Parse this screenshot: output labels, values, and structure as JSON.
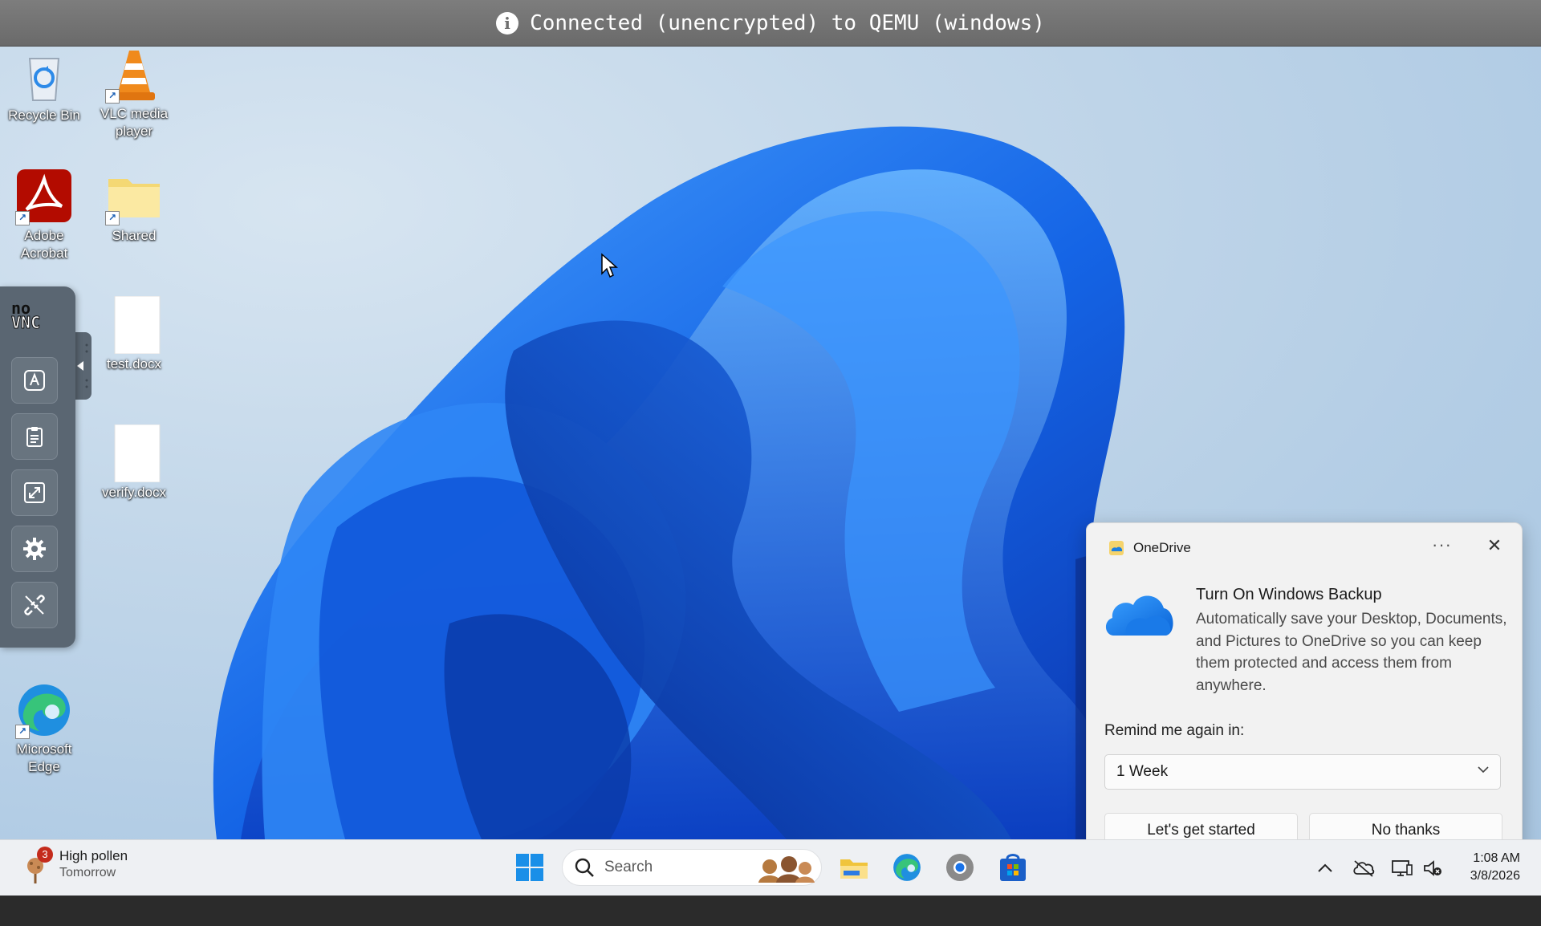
{
  "vnc": {
    "status_text": "Connected (unencrypted) to QEMU (windows)"
  },
  "desktop": {
    "icons": [
      {
        "label": "Recycle Bin",
        "icon": "recycle-bin-icon"
      },
      {
        "label": "VLC media player",
        "icon": "vlc-icon"
      },
      {
        "label": "Adobe Acrobat",
        "icon": "adobe-acrobat-icon"
      },
      {
        "label": "Shared",
        "icon": "folder-icon"
      },
      {
        "label": "test.docx",
        "icon": "document-icon"
      },
      {
        "label": "verify.docx",
        "icon": "document-icon"
      },
      {
        "label": "Microsoft Edge",
        "icon": "edge-icon"
      }
    ]
  },
  "novnc": {
    "logo_top": "no",
    "logo_bottom": "VNC",
    "buttons": [
      "keyboard-icon",
      "clipboard-icon",
      "fullscreen-icon",
      "settings-icon",
      "disconnect-icon"
    ]
  },
  "toast": {
    "app_name": "OneDrive",
    "more_label": "···",
    "close_label": "✕",
    "title": "Turn On Windows Backup",
    "body": "Automatically save your Desktop, Documents, and Pictures to OneDrive so you can keep them protected and access them from anywhere.",
    "remind_label": "Remind me again in:",
    "remind_value": "1 Week",
    "primary_button": "Let's get started",
    "secondary_button": "No thanks"
  },
  "taskbar": {
    "weather_badge": "3",
    "weather_title": "High pollen",
    "weather_subtitle": "Tomorrow",
    "search_placeholder": "Search",
    "tray_chevron": "^",
    "time": "1:08 AM",
    "date": "3/8/2026"
  }
}
